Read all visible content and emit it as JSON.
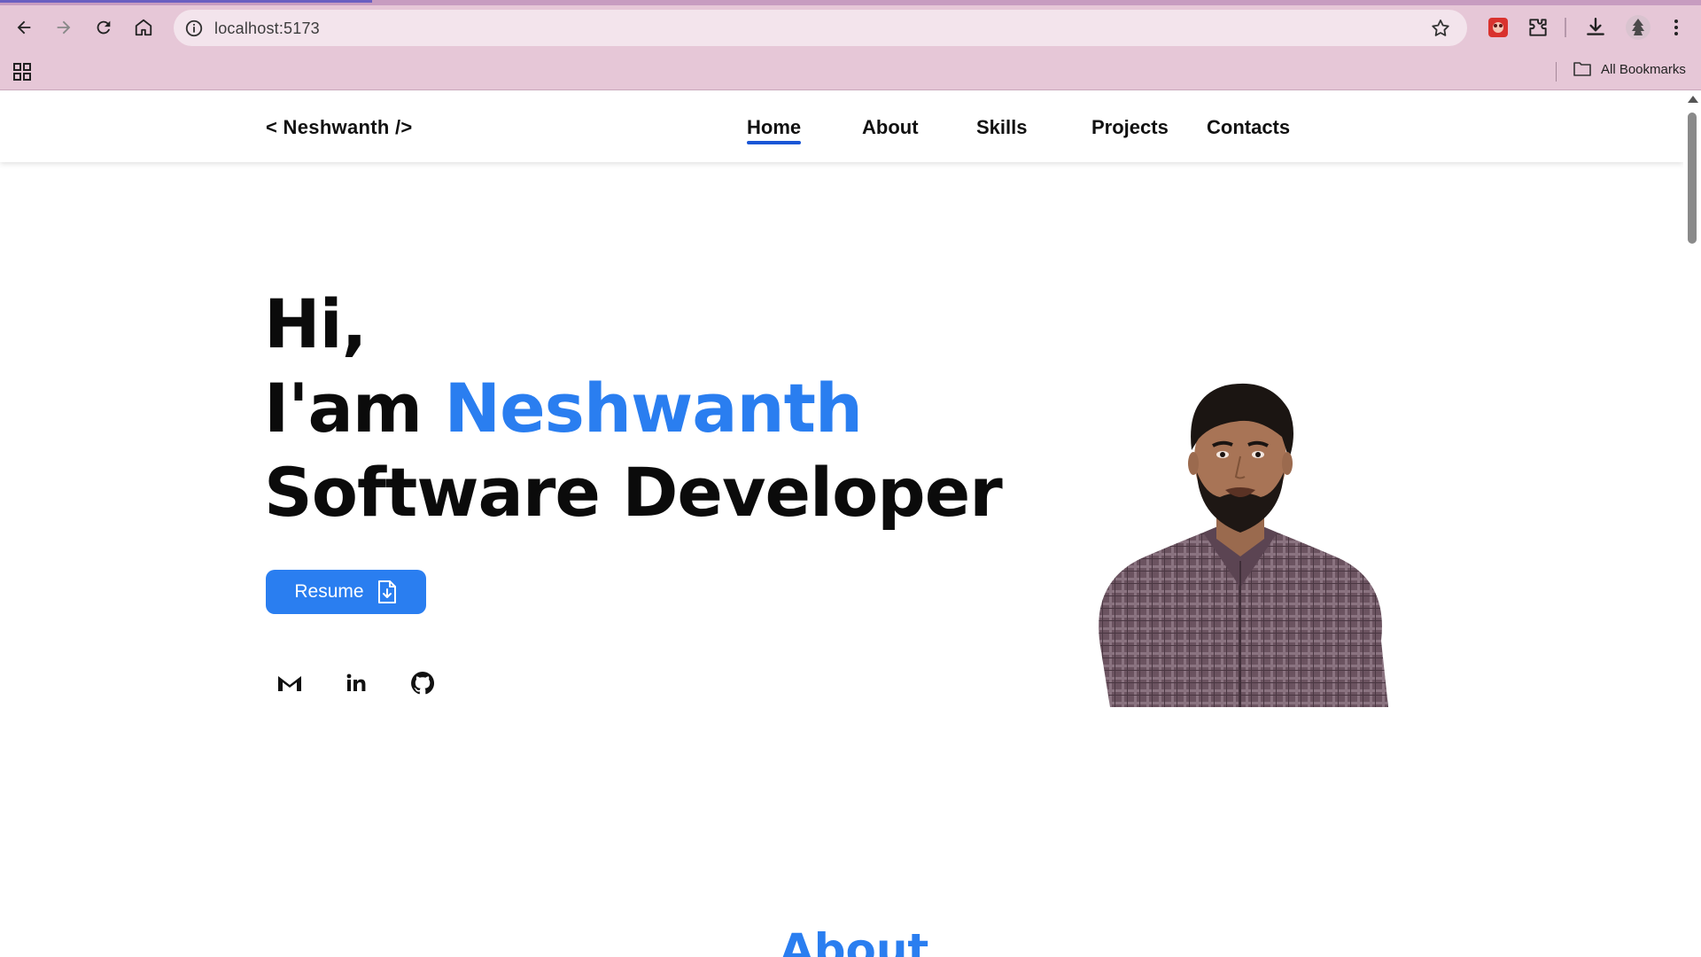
{
  "browser": {
    "url": "localhost:5173",
    "bookmarks_label": "All Bookmarks",
    "accent_color": "#e6c7d7"
  },
  "site": {
    "logo": "< Neshwanth />",
    "nav": [
      {
        "label": "Home",
        "active": true
      },
      {
        "label": "About",
        "active": false
      },
      {
        "label": "Skills",
        "active": false
      },
      {
        "label": "Projects",
        "active": false
      },
      {
        "label": "Contacts",
        "active": false
      }
    ]
  },
  "hero": {
    "greeting": "Hi,",
    "intro": "I'am",
    "name": "Neshwanth",
    "role": "Software Developer",
    "resume_label": "Resume",
    "accent_color": "#2a7ef0",
    "socials": [
      {
        "icon": "gmail-icon"
      },
      {
        "icon": "linkedin-icon"
      },
      {
        "icon": "github-icon"
      }
    ]
  },
  "about": {
    "heading": "About"
  }
}
